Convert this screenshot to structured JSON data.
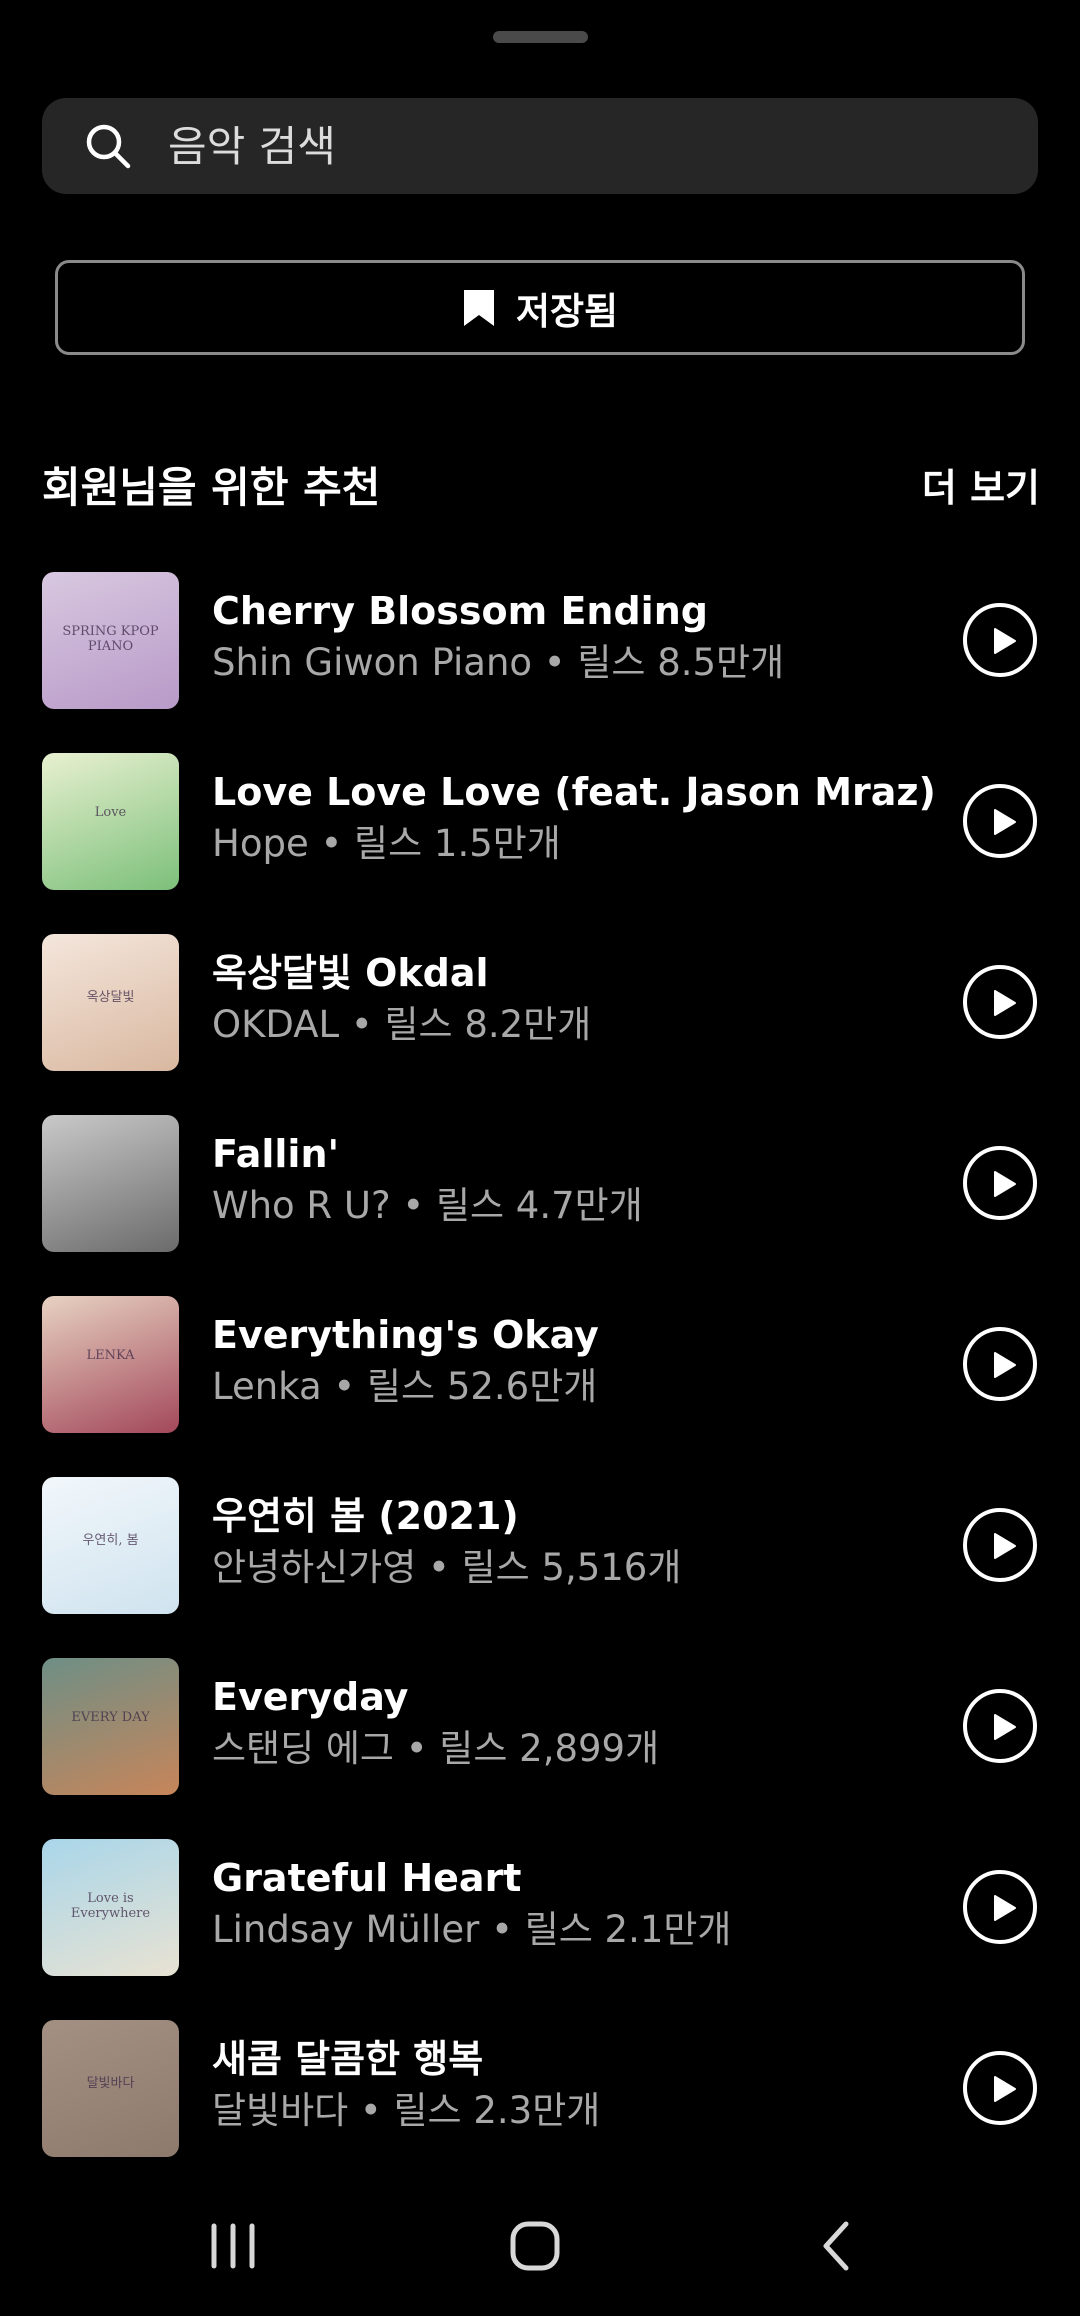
{
  "search": {
    "placeholder": "음악 검색",
    "icon": "search-icon"
  },
  "saved_button": {
    "label": "저장됨",
    "icon": "bookmark-icon"
  },
  "section": {
    "title": "회원님을 위한 추천",
    "more_label": "더 보기"
  },
  "tracks": [
    {
      "title": "Cherry Blossom Ending",
      "subtitle": "Shin Giwon Piano • 릴스 8.5만개",
      "cover_text": "SPRING KPOP PIANO",
      "colors": [
        "#d8c8e0",
        "#b89ac8"
      ]
    },
    {
      "title": "Love Love Love (feat. Jason Mraz)",
      "subtitle": "Hope • 릴스 1.5만개",
      "cover_text": "Love",
      "colors": [
        "#e8f0d0",
        "#7cc07a"
      ]
    },
    {
      "title": "옥상달빛 Okdal",
      "subtitle": "OKDAL • 릴스 8.2만개",
      "cover_text": "옥상달빛",
      "colors": [
        "#f4e6dc",
        "#d9b8a0"
      ]
    },
    {
      "title": "Fallin'",
      "subtitle": "Who R U? • 릴스 4.7만개",
      "cover_text": "",
      "colors": [
        "#c9c9c9",
        "#6b6b6b"
      ]
    },
    {
      "title": "Everything's Okay",
      "subtitle": "Lenka • 릴스 52.6만개",
      "cover_text": "LENKA",
      "colors": [
        "#e7d2c2",
        "#a3485a"
      ]
    },
    {
      "title": "우연히 봄 (2021)",
      "subtitle": "안녕하신가영 • 릴스 5,516개",
      "cover_text": "우연히, 봄",
      "colors": [
        "#f2f7fb",
        "#cfe3ef"
      ]
    },
    {
      "title": "Everyday",
      "subtitle": "스탠딩 에그 • 릴스 2,899개",
      "cover_text": "EVERY DAY",
      "colors": [
        "#6e8f86",
        "#c7855a"
      ]
    },
    {
      "title": "Grateful Heart",
      "subtitle": "Lindsay Müller • 릴스 2.1만개",
      "cover_text": "Love is Everywhere",
      "colors": [
        "#a9d6ea",
        "#e8e2d2"
      ]
    },
    {
      "title": "새콤 달콤한 행복",
      "subtitle": "달빛바다 • 릴스 2.3만개",
      "cover_text": "달빛바다",
      "colors": [
        "#a39083",
        "#8d7a6d"
      ]
    }
  ],
  "play_icon": "play-icon",
  "navbar": {
    "icons": [
      "recent-apps-icon",
      "home-icon",
      "back-icon"
    ]
  }
}
